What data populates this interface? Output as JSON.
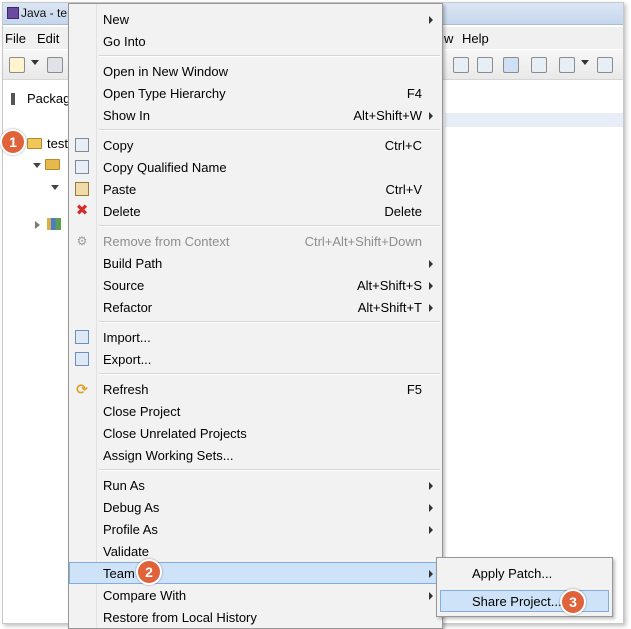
{
  "window": {
    "title": "Java - te"
  },
  "menubar": {
    "file": "File",
    "edit": "Edit",
    "window_partial": "w",
    "help": "Help"
  },
  "explorer": {
    "tab_label": "Packag",
    "project_label": "test"
  },
  "context_menu": {
    "groups": [
      [
        {
          "label": "New",
          "accel": "",
          "submenu": true
        },
        {
          "label": "Go Into",
          "accel": ""
        }
      ],
      [
        {
          "label": "Open in New Window",
          "accel": ""
        },
        {
          "label": "Open Type Hierarchy",
          "accel": "F4"
        },
        {
          "label": "Show In",
          "accel": "Alt+Shift+W",
          "submenu": true
        }
      ],
      [
        {
          "label": "Copy",
          "accel": "Ctrl+C",
          "icon": "copy-icon"
        },
        {
          "label": "Copy Qualified Name",
          "accel": "",
          "icon": "copy-qualified-icon"
        },
        {
          "label": "Paste",
          "accel": "Ctrl+V",
          "icon": "paste-icon"
        },
        {
          "label": "Delete",
          "accel": "Delete",
          "icon": "delete-icon"
        }
      ],
      [
        {
          "label": "Remove from Context",
          "accel": "Ctrl+Alt+Shift+Down",
          "disabled": true,
          "icon": "remove-context-icon"
        },
        {
          "label": "Build Path",
          "accel": "",
          "submenu": true
        },
        {
          "label": "Source",
          "accel": "Alt+Shift+S",
          "submenu": true
        },
        {
          "label": "Refactor",
          "accel": "Alt+Shift+T",
          "submenu": true
        }
      ],
      [
        {
          "label": "Import...",
          "accel": "",
          "icon": "import-icon"
        },
        {
          "label": "Export...",
          "accel": "",
          "icon": "export-icon"
        }
      ],
      [
        {
          "label": "Refresh",
          "accel": "F5",
          "icon": "refresh-icon"
        },
        {
          "label": "Close Project",
          "accel": ""
        },
        {
          "label": "Close Unrelated Projects",
          "accel": ""
        },
        {
          "label": "Assign Working Sets...",
          "accel": ""
        }
      ],
      [
        {
          "label": "Run As",
          "accel": "",
          "submenu": true
        },
        {
          "label": "Debug As",
          "accel": "",
          "submenu": true
        },
        {
          "label": "Profile As",
          "accel": "",
          "submenu": true
        },
        {
          "label": "Validate",
          "accel": ""
        },
        {
          "label": "Team",
          "accel": "",
          "submenu": true,
          "highlighted": true
        },
        {
          "label": "Compare With",
          "accel": "",
          "submenu": true
        },
        {
          "label": "Restore from Local History",
          "accel": ""
        }
      ]
    ]
  },
  "team_submenu": {
    "items": [
      {
        "label": "Apply Patch..."
      },
      {
        "label": "Share Project...",
        "highlighted": true
      }
    ]
  },
  "callouts": [
    "1",
    "2",
    "3"
  ]
}
